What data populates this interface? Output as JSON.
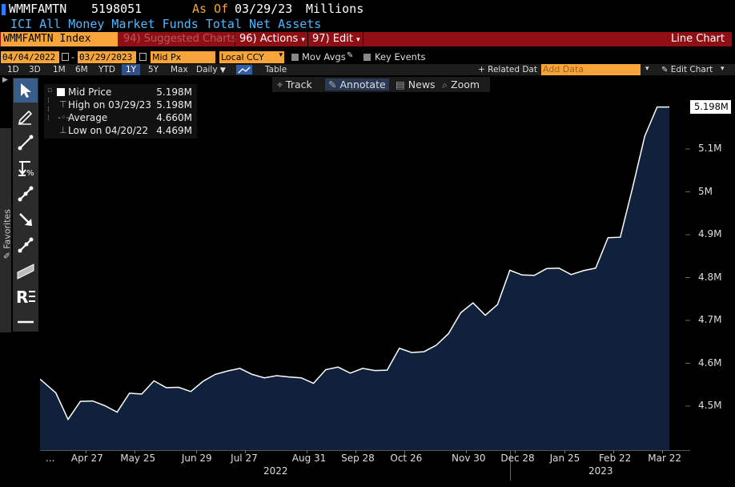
{
  "header": {
    "ticker": "WMMFAMTN",
    "value": "5198051",
    "asof_label": "As Of",
    "asof_date": "03/29/23",
    "units": "Millions",
    "description": "ICI All Money Market Funds Total Net Assets"
  },
  "menubar": {
    "index": "WMMFAMTN Index",
    "suggested": "94) Suggested Charts",
    "actions": "96) Actions",
    "edit": "97) Edit",
    "view": "Line Chart"
  },
  "controls": {
    "start_date": "04/04/2022",
    "end_date": "03/29/2023",
    "price_field": "Mid Px",
    "currency": "Local CCY",
    "mov_avgs": "Mov Avgs",
    "key_events": "Key Events"
  },
  "ranges": [
    "1D",
    "3D",
    "1M",
    "6M",
    "YTD",
    "1Y",
    "5Y",
    "Max"
  ],
  "selected_range": "1Y",
  "periodicity": "Daily",
  "table_label": "Table",
  "related_data": "+ Related Dat",
  "add_data_placeholder": "Add Data",
  "edit_chart": "Edit Chart",
  "tools": {
    "track": "Track",
    "annotate": "Annotate",
    "news": "News",
    "zoom": "Zoom"
  },
  "sidebar": {
    "favorites": "Favorites",
    "tools": [
      "pointer-icon",
      "pen-icon",
      "trendline-icon",
      "fib-percent-icon",
      "channel-icon",
      "arrow-icon",
      "segment-icon",
      "rectangle-icon",
      "text-icon",
      "horizontal-line-icon"
    ]
  },
  "legend": {
    "series": "Mid Price",
    "series_value": "5.198M",
    "high_label": "High on 03/29/23",
    "high_value": "5.198M",
    "avg_label": "Average",
    "avg_value": "4.660M",
    "low_label": "Low on 04/20/22",
    "low_value": "4.469M"
  },
  "chart_data": {
    "type": "area",
    "title": "ICI All Money Market Funds Total Net Assets",
    "ylabel": "Millions",
    "ylim": [
      4.4,
      5.25
    ],
    "yticks": [
      "4.5M",
      "4.6M",
      "4.7M",
      "4.8M",
      "4.9M",
      "5M",
      "5.1M"
    ],
    "last_value_label": "5.198M",
    "xticks": [
      "Apr 27",
      "May 25",
      "Jun 29",
      "Jul 27",
      "Aug 31",
      "Sep 28",
      "Oct 26",
      "Nov 30",
      "Dec 28",
      "Jan 25",
      "Feb 22",
      "Mar 22"
    ],
    "xtick_values": [
      26,
      54,
      89,
      117,
      152,
      180,
      208,
      243,
      271,
      299,
      327,
      355
    ],
    "years": [
      "2022",
      "2023"
    ],
    "colors": {
      "fill": "#10223b",
      "line": "#ffffff"
    },
    "x_days": [
      0,
      9,
      16,
      23,
      30,
      37,
      44,
      51,
      58,
      65,
      72,
      79,
      86,
      93,
      100,
      107,
      114,
      121,
      128,
      135,
      142,
      149,
      156,
      163,
      170,
      177,
      184,
      191,
      198,
      205,
      212,
      219,
      226,
      233,
      240,
      247,
      254,
      261,
      268,
      275,
      282,
      289,
      296,
      303,
      310,
      317,
      324,
      331,
      338,
      345,
      352,
      359
    ],
    "values": [
      4.563,
      4.531,
      4.469,
      4.511,
      4.512,
      4.501,
      4.486,
      4.53,
      4.528,
      4.559,
      4.543,
      4.544,
      4.534,
      4.558,
      4.574,
      4.582,
      4.588,
      4.574,
      4.566,
      4.571,
      4.568,
      4.566,
      4.553,
      4.585,
      4.591,
      4.577,
      4.588,
      4.583,
      4.584,
      4.635,
      4.625,
      4.627,
      4.642,
      4.669,
      4.718,
      4.741,
      4.712,
      4.737,
      4.817,
      4.806,
      4.805,
      4.821,
      4.822,
      4.807,
      4.816,
      4.822,
      4.893,
      4.894,
      5.009,
      5.13,
      5.198,
      5.198
    ]
  }
}
